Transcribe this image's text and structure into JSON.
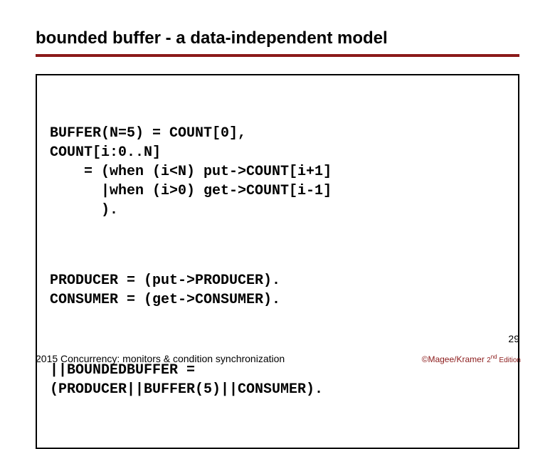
{
  "title": "bounded buffer  -  a data-independent model",
  "code": {
    "block1": "BUFFER(N=5) = COUNT[0],\nCOUNT[i:0..N]\n    = (when (i<N) put->COUNT[i+1]\n      |when (i>0) get->COUNT[i-1]\n      ).",
    "block2": "PRODUCER = (put->PRODUCER).\nCONSUMER = (get->CONSUMER).",
    "block3": "||BOUNDEDBUFFER = \n(PRODUCER||BUFFER(5)||CONSUMER)."
  },
  "page_number": "29",
  "footer_left": "2015  Concurrency: monitors & condition synchronization",
  "footer_right_prefix": "©Magee/Kramer ",
  "footer_right_edition": "2",
  "footer_right_suffix": " Edition"
}
